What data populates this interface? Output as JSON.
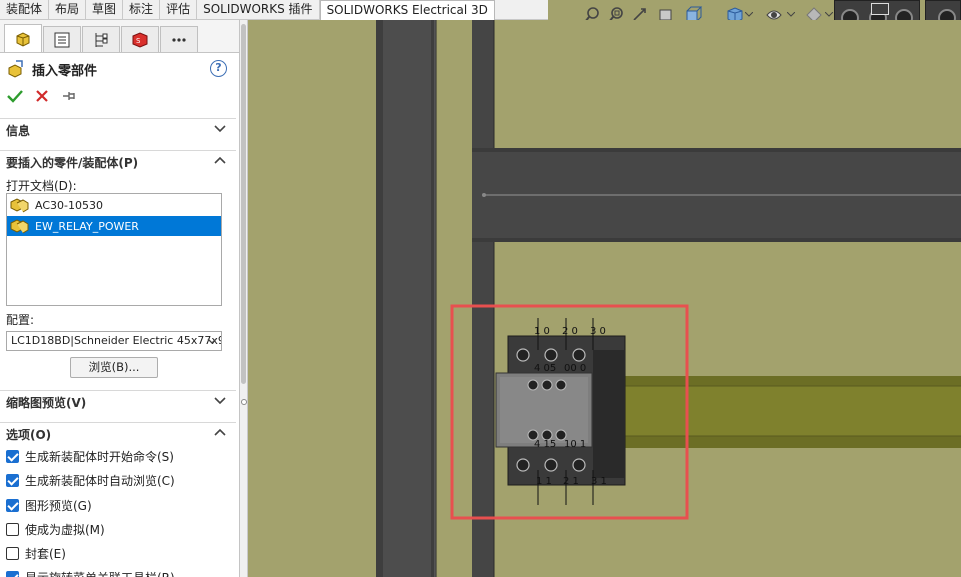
{
  "tabs": [
    {
      "label": "装配体"
    },
    {
      "label": "布局"
    },
    {
      "label": "草图"
    },
    {
      "label": "标注"
    },
    {
      "label": "评估"
    },
    {
      "label": "SOLIDWORKS 插件"
    },
    {
      "label": "SOLIDWORKS Electrical 3D"
    }
  ],
  "property_manager": {
    "title": "插入零部件",
    "help": "?",
    "sections": {
      "info": "信息",
      "part_to_insert": "要插入的零件/装配体(P)",
      "thumbnail": "缩略图预览(V)",
      "options": "选项(O)"
    },
    "open_documents_label": "打开文档(D):",
    "documents": [
      {
        "name": "AC30-10530",
        "selected": false
      },
      {
        "name": "EW_RELAY_POWER",
        "selected": true
      }
    ],
    "config_label": "配置:",
    "config_value": "LC1D18BD|Schneider Electric 45x77x9",
    "browse_label": "浏览(B)...",
    "options": [
      {
        "label": "生成新装配体时开始命令(S)",
        "checked": true
      },
      {
        "label": "生成新装配体时自动浏览(C)",
        "checked": true
      },
      {
        "label": "图形预览(G)",
        "checked": true
      },
      {
        "label": "使成为虚拟(M)",
        "checked": false
      },
      {
        "label": "封套(E)",
        "checked": false
      },
      {
        "label": "显示旋转菜单关联工具栏(R)",
        "checked": true
      }
    ]
  },
  "viewport": {
    "terminal_labels_top": [
      "1 0",
      "2 0",
      "3 0"
    ],
    "terminal_labels_mid_top": [
      "4 05",
      "00 0"
    ],
    "terminal_labels_mid_bottom": [
      "4 15",
      "10 1"
    ],
    "terminal_labels_bottom": [
      "1 1",
      "2 1",
      "3 1"
    ],
    "colors": {
      "background": "#a3a26d",
      "rail": "#4b4b4b",
      "din_rail": "#7f812d",
      "highlight": "#e8504f"
    }
  }
}
